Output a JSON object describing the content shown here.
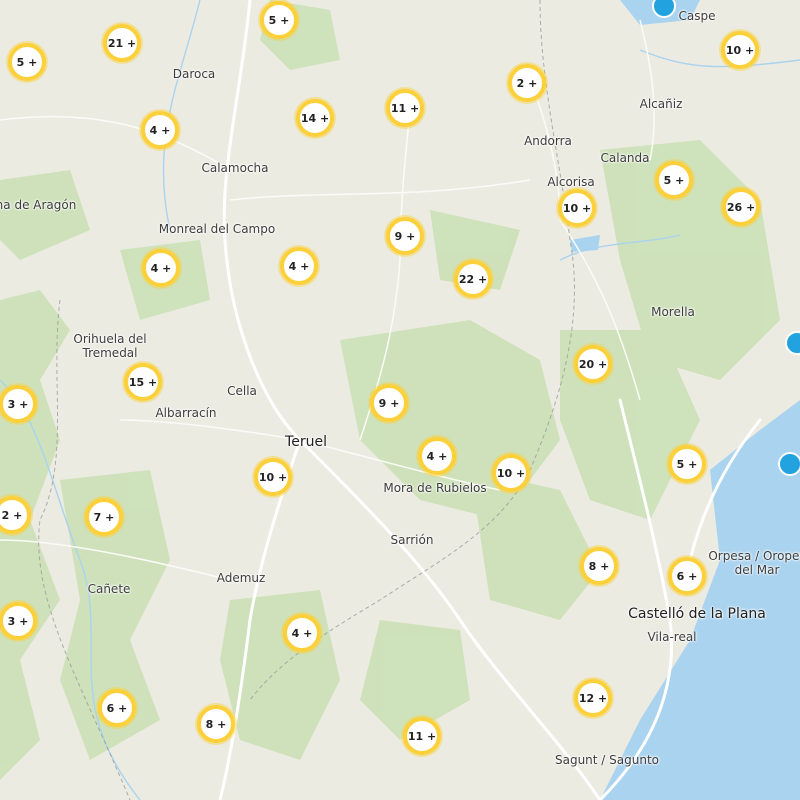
{
  "place_labels": [
    {
      "name": "Caspe",
      "size": "small"
    },
    {
      "name": "Daroca",
      "size": "small"
    },
    {
      "name": "Alcañiz",
      "size": "small"
    },
    {
      "name": "Andorra",
      "size": "small"
    },
    {
      "name": "Calamocha",
      "size": "small"
    },
    {
      "name": "Calanda",
      "size": "small"
    },
    {
      "name": "Alcorisa",
      "size": "small"
    },
    {
      "name": "na de Aragón",
      "size": "small"
    },
    {
      "name": "Monreal del Campo",
      "size": "small"
    },
    {
      "name": "Morella",
      "size": "small"
    },
    {
      "name": "Orihuela del\nTremedal",
      "size": "small"
    },
    {
      "name": "Cella",
      "size": "small"
    },
    {
      "name": "Albarracín",
      "size": "small"
    },
    {
      "name": "Teruel",
      "size": "large"
    },
    {
      "name": "Mora de Rubielos",
      "size": "small"
    },
    {
      "name": "Sarrión",
      "size": "small"
    },
    {
      "name": "Orpesa / Oropes\ndel Mar",
      "size": "small"
    },
    {
      "name": "Cañete",
      "size": "small"
    },
    {
      "name": "Ademuz",
      "size": "small"
    },
    {
      "name": "Castelló de la Plana",
      "size": "large"
    },
    {
      "name": "Vila-real",
      "size": "small"
    },
    {
      "name": "Sagunt / Sagunto",
      "size": "small"
    }
  ],
  "clusters": [
    "5 +",
    "21 +",
    "5 +",
    "10 +",
    "2 +",
    "11 +",
    "14 +",
    "4 +",
    "5 +",
    "10 +",
    "26 +",
    "9 +",
    "4 +",
    "4 +",
    "22 +",
    "20 +",
    "15 +",
    "3 +",
    "9 +",
    "4 +",
    "10 +",
    "10 +",
    "5 +",
    "2 +",
    "7 +",
    "8 +",
    "6 +",
    "3 +",
    "4 +",
    "6 +",
    "12 +",
    "8 +",
    "11 +"
  ],
  "markers": [
    "marker",
    "marker",
    "marker",
    "marker"
  ],
  "colors": {
    "land": "#ecebe2",
    "forest": "#c5dfb0",
    "water": "#a9d3ef",
    "cluster_border": "#fbd03a",
    "marker": "#22a3e0",
    "road": "#ffffff"
  }
}
